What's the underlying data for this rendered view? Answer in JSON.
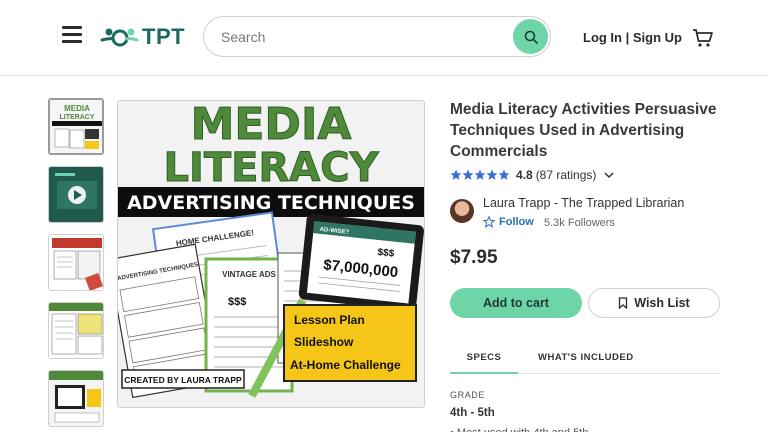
{
  "header": {
    "logo_text": "TPT",
    "search_placeholder": "Search",
    "auth_label": "Log In | Sign Up"
  },
  "thumbnails": [
    {
      "caption": "MEDIA LITERACY"
    },
    {
      "caption": ""
    },
    {
      "caption": ""
    },
    {
      "caption": "ADVERTISING TECHNIQUES"
    },
    {
      "caption": ""
    }
  ],
  "main_image": {
    "line1": "MEDIA",
    "line2": "LITERACY",
    "banner": "ADVERTISING TECHNIQUES",
    "tablet_heading": "AD-WISE?",
    "tablet_amount": "$7,000,000",
    "tablet_dollars": "$$$",
    "callout": [
      "Lesson Plan",
      "Slideshow",
      "At-Home Challenge"
    ],
    "credit": "CREATED BY LAURA TRAPP",
    "sheet_vintage": "VINTAGE ADS",
    "sheet_challenge": "HOME CHALLENGE!",
    "sheet_techniques": "5 ADVERTISING TECHNIQUES"
  },
  "product": {
    "title": "Media Literacy Activities Persuasive Techniques Used in Advertising Commercials",
    "rating": "4.8",
    "rating_count": "(87 ratings)",
    "seller_name": "Laura Trapp - The Trapped Librarian",
    "follow_label": "Follow",
    "followers": "5.3k Followers",
    "price": "$7.95",
    "add_to_cart": "Add to cart",
    "wish_list": "Wish List"
  },
  "tabs": {
    "specs": "SPECS",
    "included": "WHAT'S INCLUDED"
  },
  "specs": {
    "grade_label": "GRADE",
    "grade_value": "4th - 5th",
    "partial_line": "• Most used with 4th and 5th"
  },
  "colors": {
    "accent": "#6dd5a8",
    "brand": "#1a6a5f",
    "star": "#3a6fd8",
    "green_title": "#4e8a3a"
  }
}
